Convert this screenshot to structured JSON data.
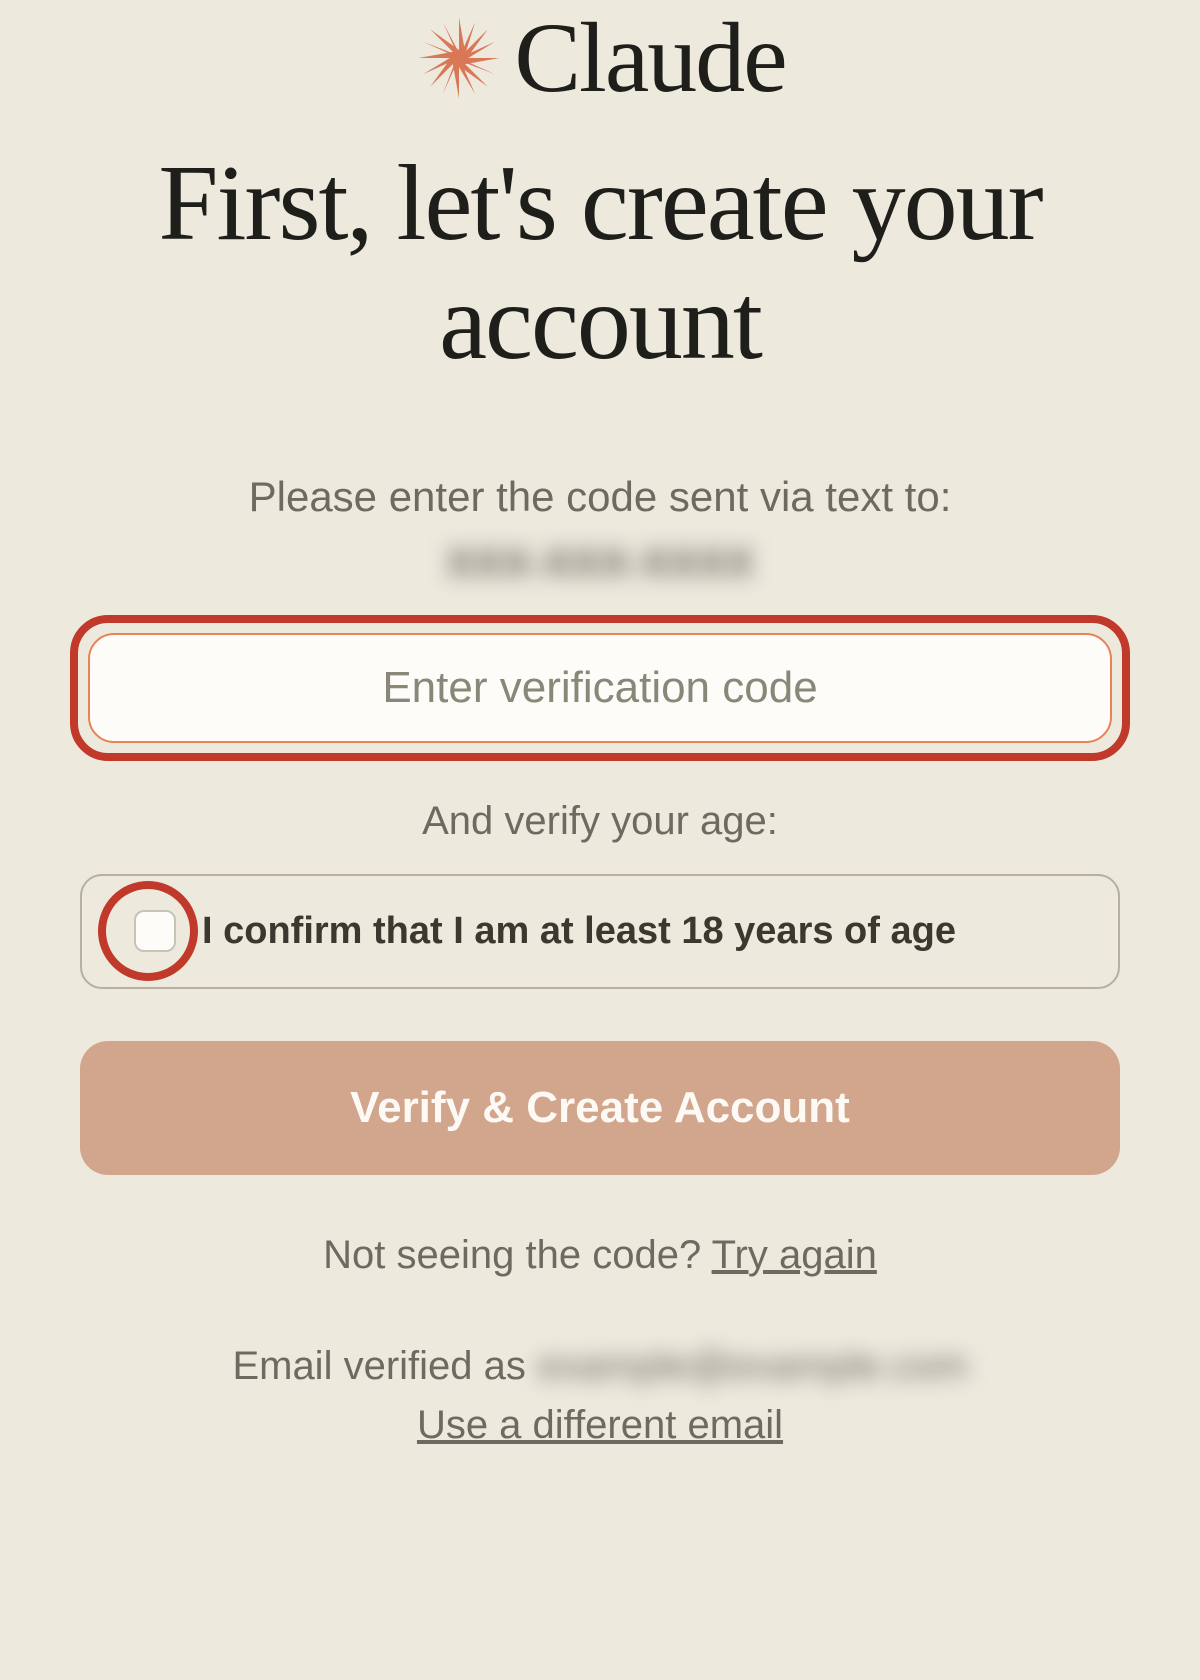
{
  "logo": {
    "text": "Claude"
  },
  "headline": "First, let's create your account",
  "instruction": "Please enter the code sent via text to:",
  "phone_blurred": "XXX-XXX-XXXX",
  "code_input": {
    "placeholder": "Enter verification code",
    "value": ""
  },
  "age_section": {
    "label": "And verify your age:",
    "checkbox_text": "I confirm that I am at least 18 years of age"
  },
  "verify_button": "Verify & Create Account",
  "retry": {
    "prefix": "Not seeing the code? ",
    "link": "Try again"
  },
  "email": {
    "prefix": "Email verified as ",
    "blurred": "example@example.com",
    "different_link": "Use a different email"
  },
  "colors": {
    "background": "#ede9dd",
    "accent": "#d2a58d",
    "highlight": "#c0392b",
    "logo_icon": "#d97757"
  }
}
